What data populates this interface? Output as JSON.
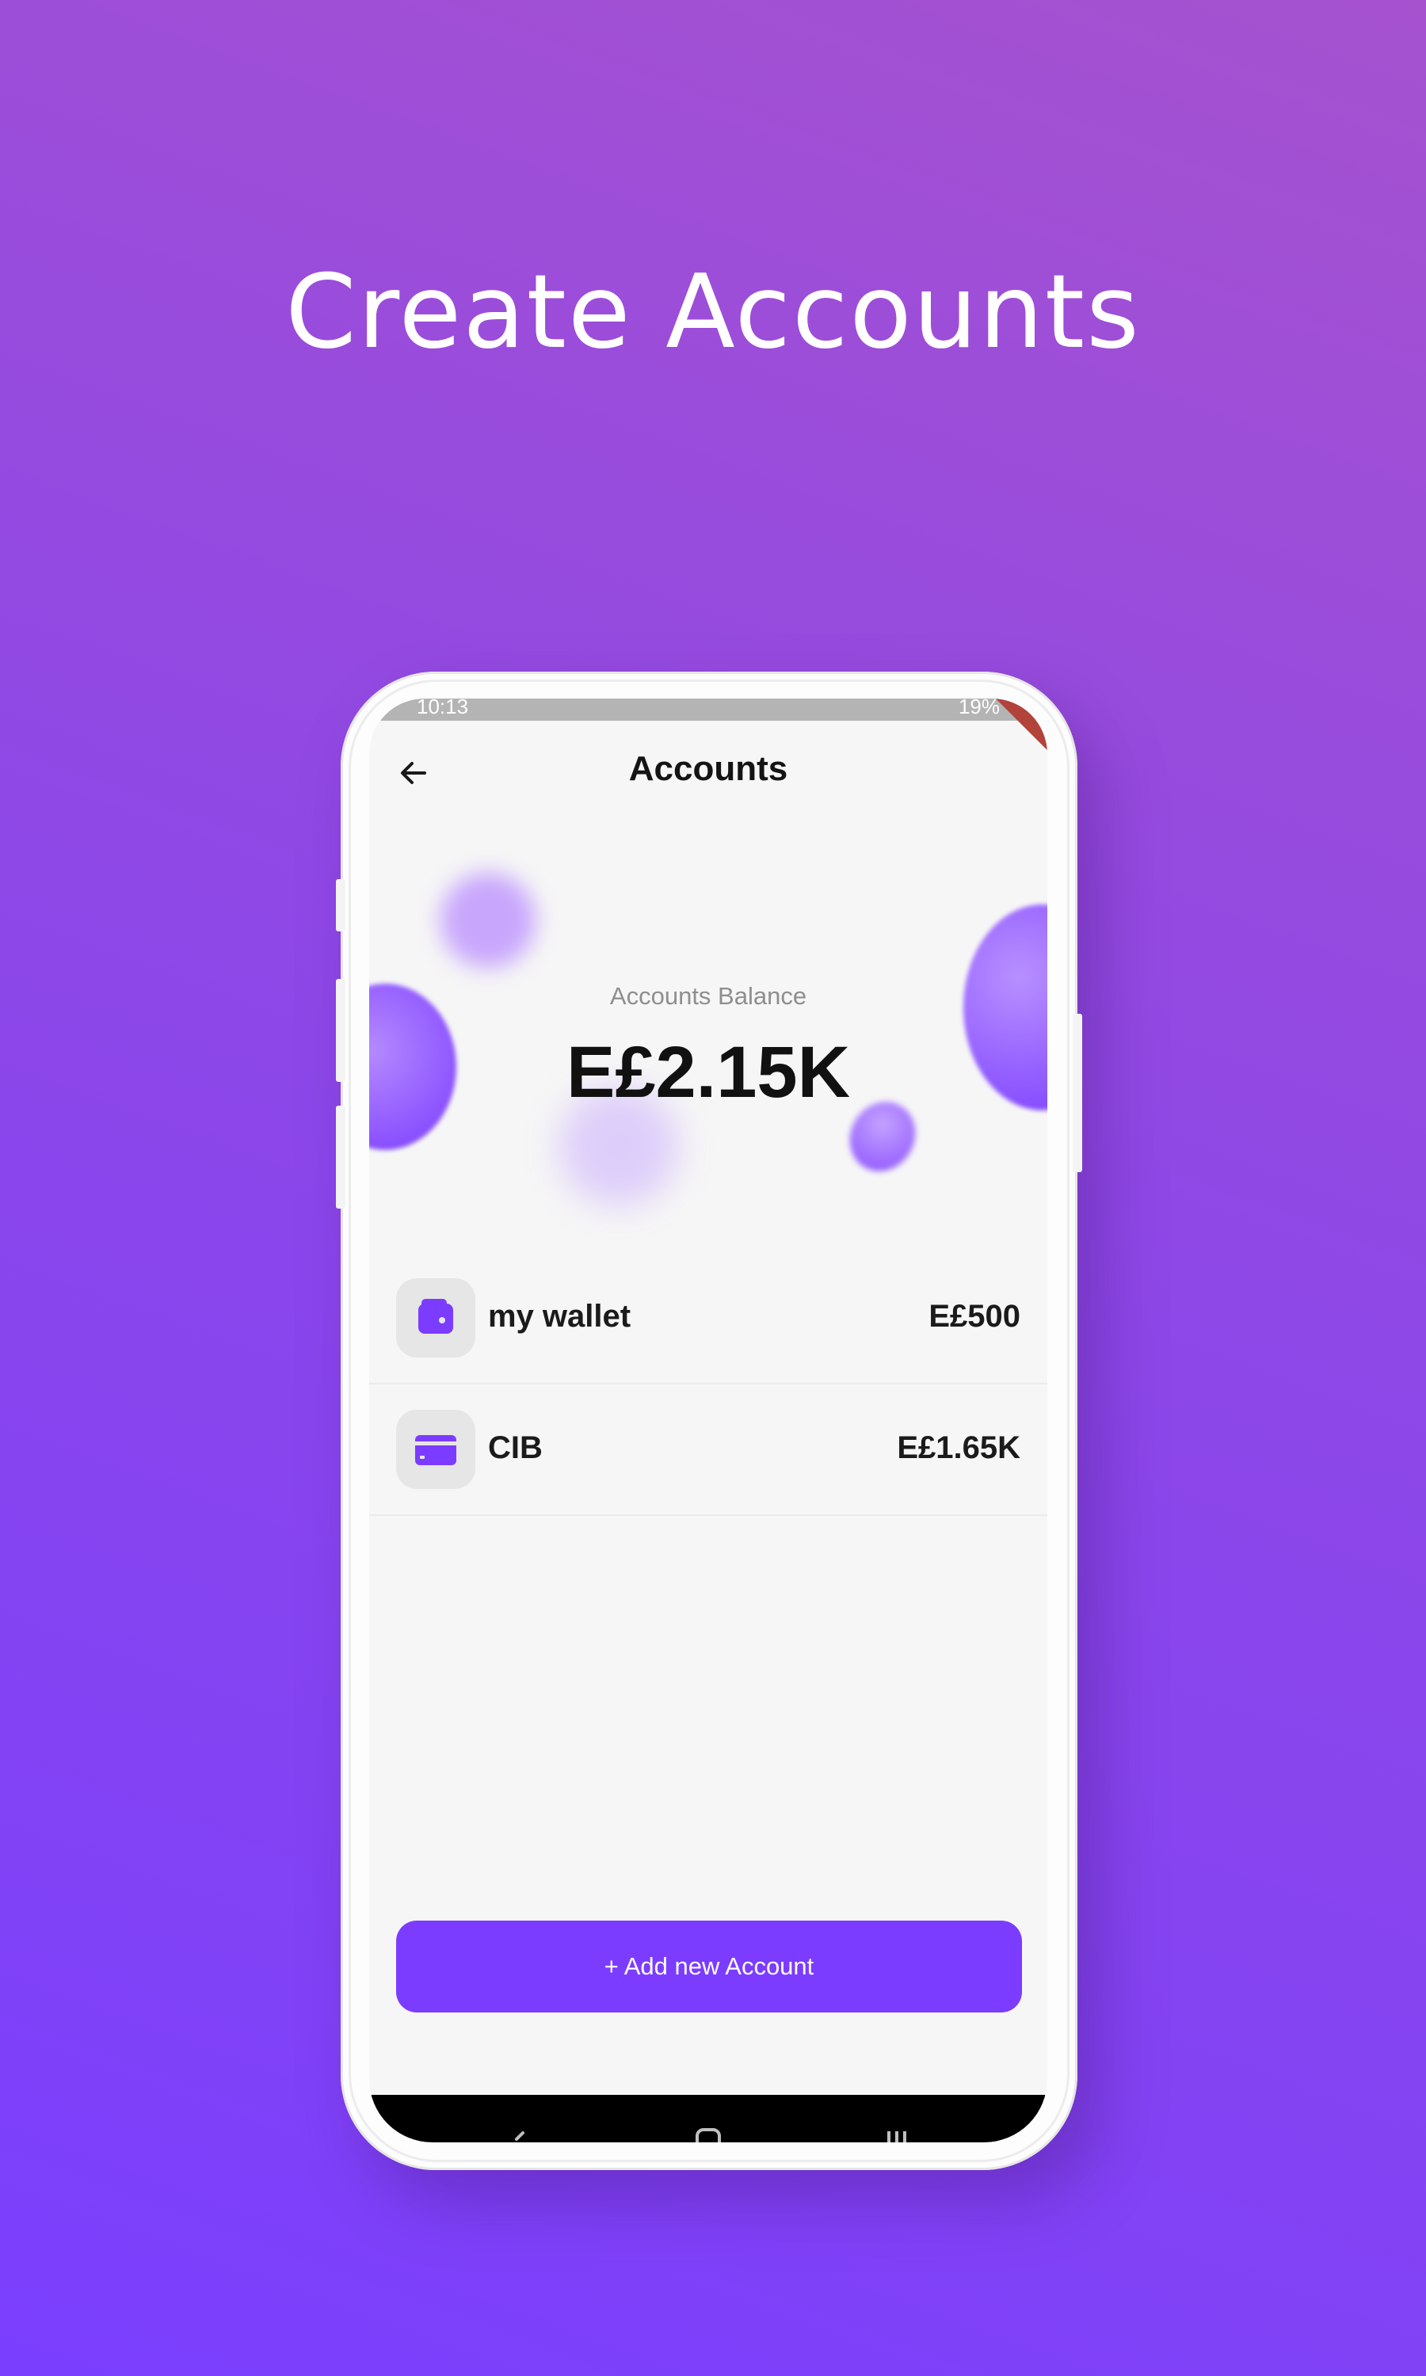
{
  "headline": "Create Accounts",
  "status_bar": {
    "time": "10:13",
    "battery": "19%"
  },
  "appbar": {
    "title": "Accounts",
    "back_icon": "arrow-left-icon"
  },
  "balance": {
    "label": "Accounts Balance",
    "value": "E£2.15K"
  },
  "accounts": [
    {
      "name": "my wallet",
      "amount": "E£500",
      "icon": "wallet-icon"
    },
    {
      "name": "CIB",
      "amount": "E£1.65K",
      "icon": "credit-card-icon"
    }
  ],
  "add_button": {
    "label": "+ Add new Account"
  },
  "navbar": {
    "back_icon": "nav-back-icon",
    "home_icon": "nav-home-icon",
    "recents_icon": "nav-recents-icon"
  },
  "colors": {
    "accent": "#7c3cff",
    "background_top": "#a652cf",
    "background_bottom": "#7a3ffe",
    "screen_bg": "#f6f6f6"
  }
}
